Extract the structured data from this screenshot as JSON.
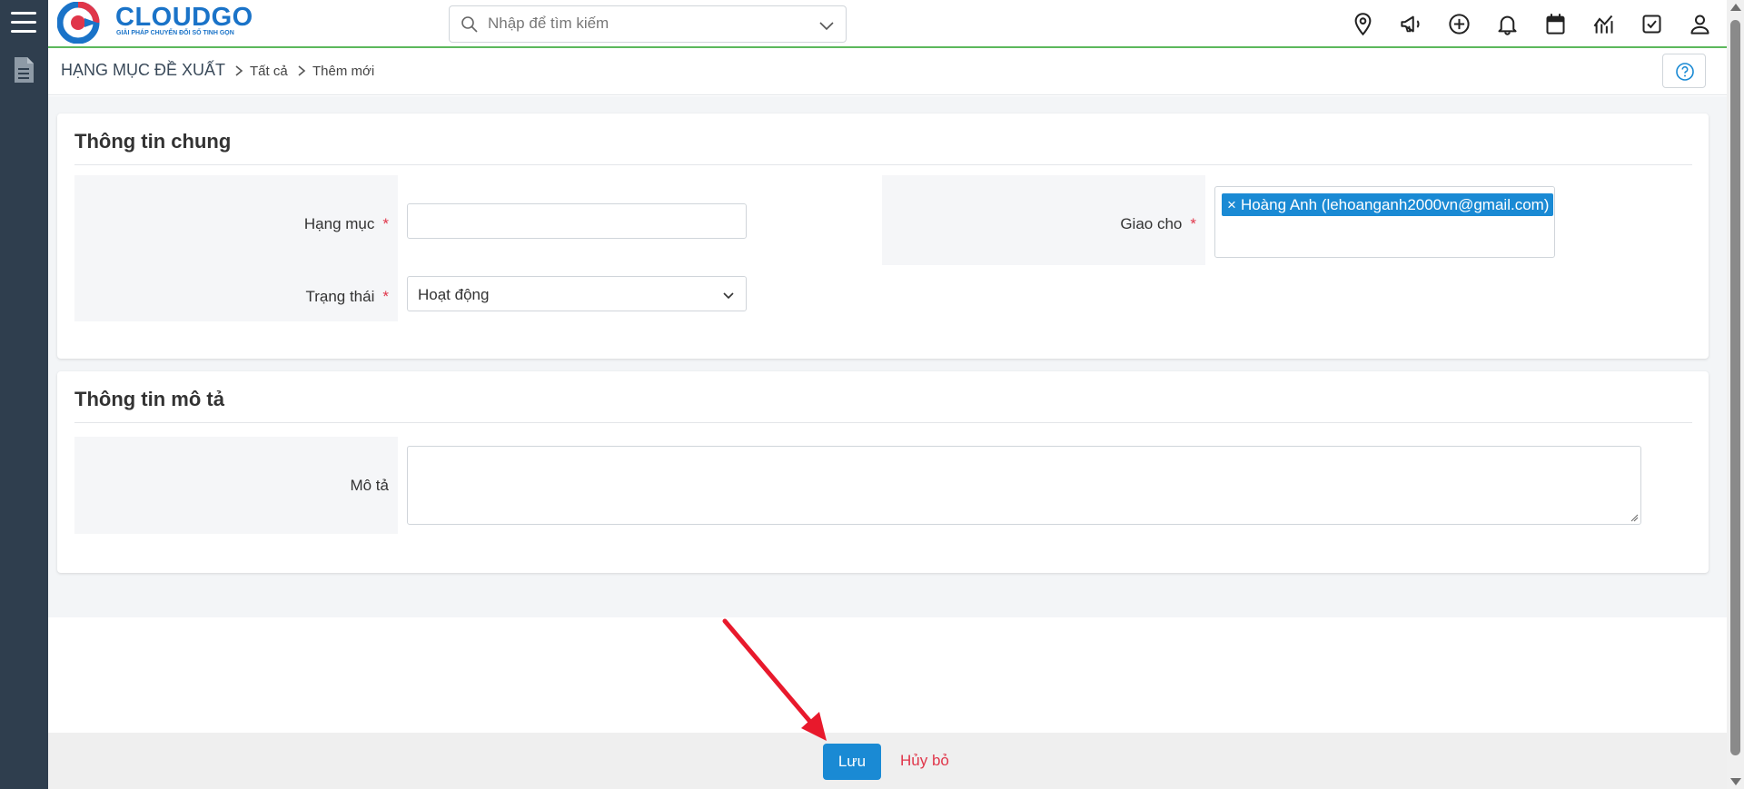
{
  "brand": {
    "name": "CLOUDGO",
    "tagline": "GIẢI PHÁP CHUYỂN ĐỔI SỐ TINH GỌN",
    "color": "#1a73c8"
  },
  "search": {
    "placeholder": "Nhập để tìm kiếm"
  },
  "header_icons": [
    "location-pin-icon",
    "megaphone-icon",
    "plus-circle-icon",
    "bell-icon",
    "calendar-icon",
    "chart-icon",
    "checkbox-icon",
    "user-icon"
  ],
  "breadcrumb": {
    "root": "HẠNG MỤC ĐỀ XUẤT",
    "level1": "Tất cả",
    "level2": "Thêm mới"
  },
  "section_general": {
    "title": "Thông tin chung",
    "fields": {
      "category": {
        "label": "Hạng mục",
        "required_mark": "*",
        "value": ""
      },
      "status": {
        "label": "Trạng thái",
        "required_mark": "*",
        "value": "Hoạt động"
      },
      "assign": {
        "label": "Giao cho",
        "required_mark": "*",
        "tag": "Hoàng Anh (lehoanganh2000vn@gmail.com)",
        "tag_remove": "×"
      }
    }
  },
  "section_description": {
    "title": "Thông tin mô tả",
    "fields": {
      "description": {
        "label": "Mô tả",
        "value": ""
      }
    }
  },
  "actions": {
    "save_label": "Lưu",
    "cancel_label": "Hủy bỏ"
  },
  "colors": {
    "primary": "#1a8ad4",
    "danger": "#e0364a",
    "sidebar": "#2f3e4e",
    "accent_line": "#5cb85c"
  }
}
